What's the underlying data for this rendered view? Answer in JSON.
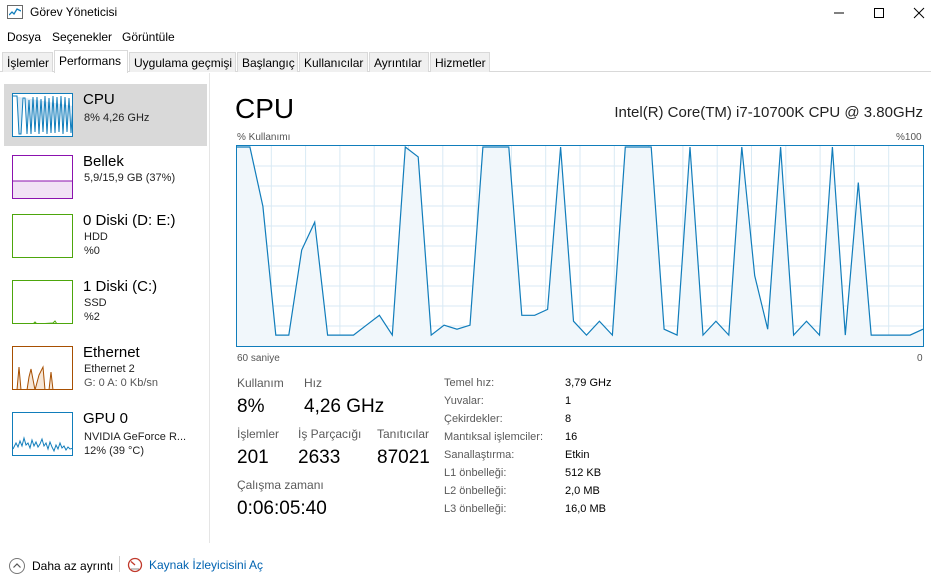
{
  "window": {
    "title": "Görev Yöneticisi"
  },
  "menu": [
    "Dosya",
    "Seçenekler",
    "Görüntüle"
  ],
  "tabs": [
    "İşlemler",
    "Performans",
    "Uygulama geçmişi",
    "Başlangıç",
    "Kullanıcılar",
    "Ayrıntılar",
    "Hizmetler"
  ],
  "active_tab": "Performans",
  "sidebar": {
    "items": [
      {
        "title": "CPU",
        "lines": [
          "8%  4,26 GHz"
        ],
        "color": "#117dbb"
      },
      {
        "title": "Bellek",
        "lines": [
          "5,9/15,9 GB (37%)"
        ],
        "color": "#8b12ae"
      },
      {
        "title": "0 Diski (D: E:)",
        "lines": [
          "HDD",
          "%0"
        ],
        "color": "#4da60c"
      },
      {
        "title": "1 Diski (C:)",
        "lines": [
          "SSD",
          "%2"
        ],
        "color": "#4da60c"
      },
      {
        "title": "Ethernet",
        "lines": [
          "Ethernet 2",
          "G: 0  A: 0 Kb/sn"
        ],
        "color": "#a74f01"
      },
      {
        "title": "GPU 0",
        "lines": [
          "NVIDIA GeForce R...",
          "12%  (39 °C)"
        ],
        "color": "#117dbb"
      }
    ]
  },
  "cpu": {
    "title": "CPU",
    "model": "Intel(R) Core(TM) i7-10700K CPU @ 3.80GHz",
    "graph_label_left": "% Kullanımı",
    "graph_label_right": "%100",
    "time_label_left": "60 saniye",
    "time_label_right": "0",
    "line_color": "#117dbb",
    "usage_series": [
      100,
      100,
      70,
      5,
      5,
      48,
      62,
      5,
      5,
      5,
      10,
      15,
      5,
      100,
      95,
      5,
      10,
      8,
      10,
      100,
      100,
      100,
      15,
      15,
      18,
      100,
      12,
      5,
      12,
      5,
      100,
      100,
      100,
      8,
      5,
      100,
      5,
      12,
      5,
      100,
      35,
      8,
      100,
      5,
      12,
      5,
      100,
      5,
      82,
      5,
      5,
      5,
      5,
      8
    ]
  },
  "stats": {
    "utilization_label": "Kullanım",
    "utilization_value": "8%",
    "speed_label": "Hız",
    "speed_value": "4,26 GHz",
    "processes_label": "İşlemler",
    "processes_value": "201",
    "threads_label": "İş Parçacığı",
    "threads_value": "2633",
    "handles_label": "Tanıtıcılar",
    "handles_value": "87021",
    "uptime_label": "Çalışma zamanı",
    "uptime_value": "0:06:05:40"
  },
  "specs": [
    {
      "label": "Temel hız:",
      "value": "3,79 GHz"
    },
    {
      "label": "Yuvalar:",
      "value": "1"
    },
    {
      "label": "Çekirdekler:",
      "value": "8"
    },
    {
      "label": "Mantıksal işlemciler:",
      "value": "16"
    },
    {
      "label": "Sanallaştırma:",
      "value": "Etkin"
    },
    {
      "label": "L1 önbelleği:",
      "value": "512 KB"
    },
    {
      "label": "L2 önbelleği:",
      "value": "2,0 MB"
    },
    {
      "label": "L3 önbelleği:",
      "value": "16,0 MB"
    }
  ],
  "footer": {
    "fewer_details": "Daha az ayrıntı",
    "resource_monitor": "Kaynak İzleyicisini Aç"
  }
}
